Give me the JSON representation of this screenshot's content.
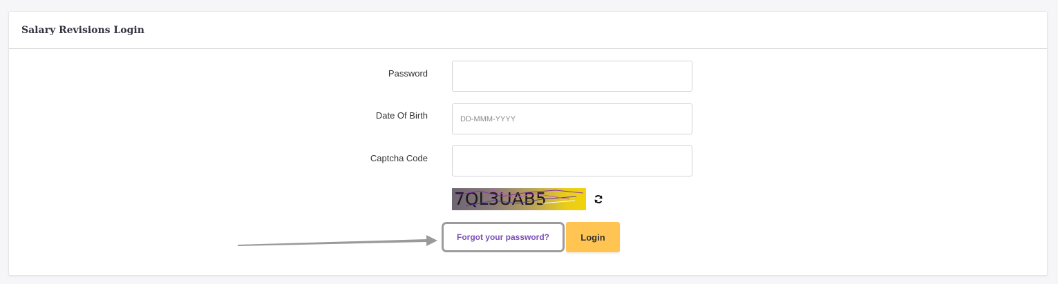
{
  "header": {
    "title": "Salary Revisions Login"
  },
  "form": {
    "password_label": "Password",
    "password_value": "",
    "dob_label": "Date Of Birth",
    "dob_placeholder": "DD-MMM-YYYY",
    "dob_value": "",
    "captcha_label": "Captcha Code",
    "captcha_value": "",
    "captcha_image_text": "7QL3UAB5",
    "refresh_icon": "refresh-icon",
    "forgot_password_label": "Forgot your password?",
    "login_label": "Login"
  },
  "annotation": {
    "arrow_icon": "arrow-right-icon",
    "highlight_color": "#9b9b9b"
  },
  "colors": {
    "link": "#7b4fb8",
    "login_button": "#ffc451"
  }
}
